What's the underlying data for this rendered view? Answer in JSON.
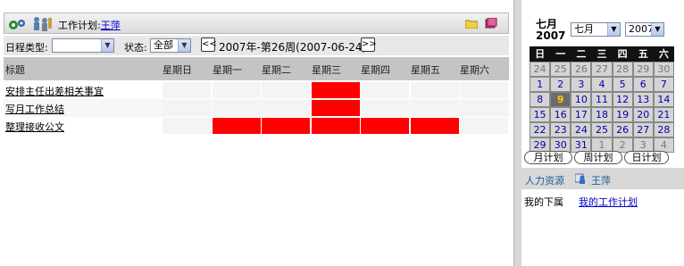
{
  "header": {
    "label": "工作计划:",
    "user_link": "王萍",
    "gear_icon": "gears-icon",
    "folder_icon": "folder-icon",
    "book_icon": "book-icon"
  },
  "filters": {
    "schedule_type_label": "日程类型:",
    "schedule_type_value": "",
    "status_label": "状态:",
    "status_value": "全部",
    "prev_label": "<<",
    "next_label": ">>",
    "week_text": "2007年-第26周(2007-06-24)"
  },
  "table": {
    "columns": [
      "标题",
      "星期日",
      "星期一",
      "星期二",
      "星期三",
      "星期四",
      "星期五",
      "星期六"
    ],
    "rows": [
      {
        "title": "安排主任出差相关事宜",
        "days": [
          false,
          false,
          false,
          true,
          false,
          false,
          false
        ]
      },
      {
        "title": "写月工作总结",
        "days": [
          false,
          false,
          false,
          true,
          false,
          false,
          false
        ]
      },
      {
        "title": "整理接收公文",
        "days": [
          false,
          true,
          true,
          true,
          true,
          true,
          false
        ]
      }
    ],
    "highlight_color": "#ff0000"
  },
  "calendar": {
    "month_label": "七月",
    "year_label": "2007",
    "month_select": "七月",
    "year_select": "2007",
    "weekdays": [
      "日",
      "一",
      "二",
      "三",
      "四",
      "五",
      "六"
    ],
    "weeks": [
      [
        "24",
        "25",
        "26",
        "27",
        "28",
        "29",
        "30"
      ],
      [
        "1",
        "2",
        "3",
        "4",
        "5",
        "6",
        "7"
      ],
      [
        "8",
        "9",
        "10",
        "11",
        "12",
        "13",
        "14"
      ],
      [
        "15",
        "16",
        "17",
        "18",
        "19",
        "20",
        "21"
      ],
      [
        "22",
        "23",
        "24",
        "25",
        "26",
        "27",
        "28"
      ],
      [
        "29",
        "30",
        "31",
        "1",
        "2",
        "3",
        "4"
      ]
    ],
    "today": "9"
  },
  "plan_buttons": [
    "月计划",
    "周计划",
    "日计划"
  ],
  "hr": {
    "label": "人力资源",
    "user": "王萍"
  },
  "subordinates": {
    "label": "我的下属",
    "link": "我的工作计划"
  }
}
